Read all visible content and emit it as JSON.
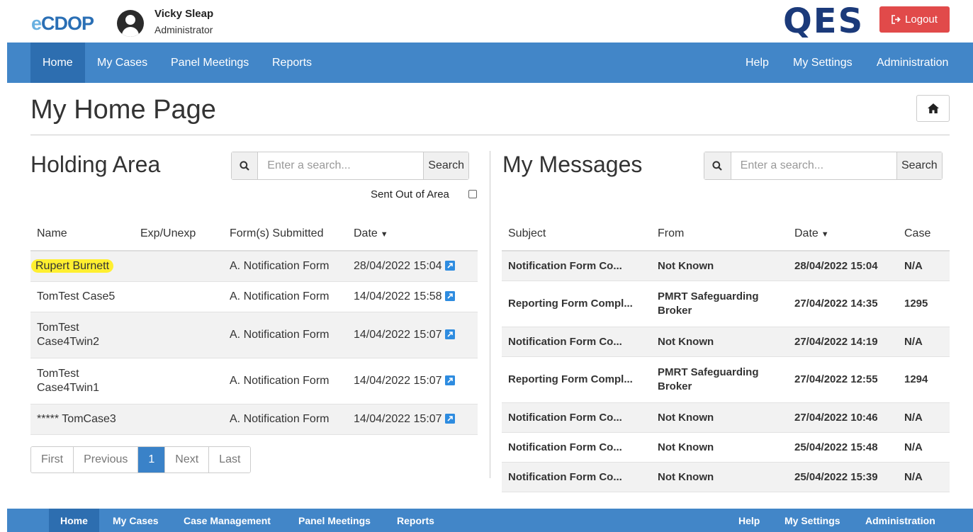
{
  "header": {
    "logo_e": "e",
    "logo_rest": "CDOP",
    "user_name": "Vicky Sleap",
    "user_role": "Administrator",
    "brand": "QES",
    "logout_label": "Logout"
  },
  "nav": {
    "left": [
      "Home",
      "My Cases",
      "Panel Meetings",
      "Reports"
    ],
    "right": [
      "Help",
      "My Settings",
      "Administration"
    ],
    "active": "Home"
  },
  "nav_bottom": {
    "left": [
      "Home",
      "My Cases",
      "Case Management",
      "Panel Meetings",
      "Reports"
    ],
    "right": [
      "Help",
      "My Settings",
      "Administration"
    ]
  },
  "page": {
    "title": "My Home Page"
  },
  "holding": {
    "title": "Holding Area",
    "search_placeholder": "Enter a search...",
    "search_label": "Search",
    "sent_out_label": "Sent Out of Area",
    "columns": [
      "Name",
      "Exp/Unexp",
      "Form(s) Submitted",
      "Date"
    ],
    "rows": [
      {
        "name": "Rupert Burnett",
        "exp": "",
        "form": "A. Notification Form",
        "date": "28/04/2022 15:04",
        "highlight": true
      },
      {
        "name": "TomTest Case5",
        "exp": "",
        "form": "A. Notification Form",
        "date": "14/04/2022 15:58"
      },
      {
        "name": "TomTest Case4Twin2",
        "exp": "",
        "form": "A. Notification Form",
        "date": "14/04/2022 15:07"
      },
      {
        "name": "TomTest Case4Twin1",
        "exp": "",
        "form": "A. Notification Form",
        "date": "14/04/2022 15:07"
      },
      {
        "name": "***** TomCase3",
        "exp": "",
        "form": "A. Notification Form",
        "date": "14/04/2022 15:07"
      }
    ],
    "pager": [
      "First",
      "Previous",
      "1",
      "Next",
      "Last"
    ],
    "current_page": "1"
  },
  "messages": {
    "title": "My Messages",
    "search_placeholder": "Enter a search...",
    "search_label": "Search",
    "columns": [
      "Subject",
      "From",
      "Date",
      "Case"
    ],
    "rows": [
      {
        "subject": "Notification Form Co...",
        "from": "Not Known",
        "date": "28/04/2022 15:04",
        "case": "N/A"
      },
      {
        "subject": "Reporting Form Compl...",
        "from": "PMRT Safeguarding Broker",
        "date": "27/04/2022 14:35",
        "case": "1295"
      },
      {
        "subject": "Notification Form Co...",
        "from": "Not Known",
        "date": "27/04/2022 14:19",
        "case": "N/A"
      },
      {
        "subject": "Reporting Form Compl...",
        "from": "PMRT Safeguarding Broker",
        "date": "27/04/2022 12:55",
        "case": "1294"
      },
      {
        "subject": "Notification Form Co...",
        "from": "Not Known",
        "date": "27/04/2022 10:46",
        "case": "N/A"
      },
      {
        "subject": "Notification Form Co...",
        "from": "Not Known",
        "date": "25/04/2022 15:48",
        "case": "N/A"
      },
      {
        "subject": "Notification Form Co...",
        "from": "Not Known",
        "date": "25/04/2022 15:39",
        "case": "N/A"
      }
    ]
  },
  "colors": {
    "nav": "#4286c8",
    "nav_active": "#2d6eb0",
    "logout": "#e14a4a",
    "brand": "#1b3a7a",
    "highlight": "#ffef30",
    "pager_active": "#3a82c8"
  }
}
